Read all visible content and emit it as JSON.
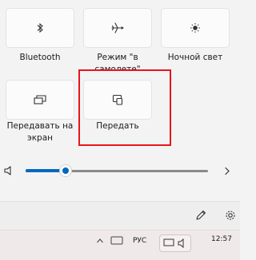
{
  "quick_settings": {
    "tiles": [
      {
        "id": "bluetooth",
        "label": "Bluetooth",
        "icon": "bluetooth-icon"
      },
      {
        "id": "airplane",
        "label": "Режим \"в самолете\"",
        "icon": "airplane-icon"
      },
      {
        "id": "night-light",
        "label": "Ночной свет",
        "icon": "night-light-icon"
      },
      {
        "id": "project",
        "label": "Передавать на экран",
        "icon": "project-icon"
      },
      {
        "id": "cast",
        "label": "Передать",
        "icon": "cast-icon"
      }
    ],
    "highlight_color": "#e8141d"
  },
  "volume": {
    "icon": "speaker-icon",
    "level_fraction": 0.22,
    "accent_color": "#0067c0",
    "next_icon": "chevron-right-icon"
  },
  "footer": {
    "edit_icon": "pencil-icon",
    "settings_icon": "gear-icon"
  },
  "taskbar": {
    "language": "РУС",
    "time": "12:57"
  }
}
